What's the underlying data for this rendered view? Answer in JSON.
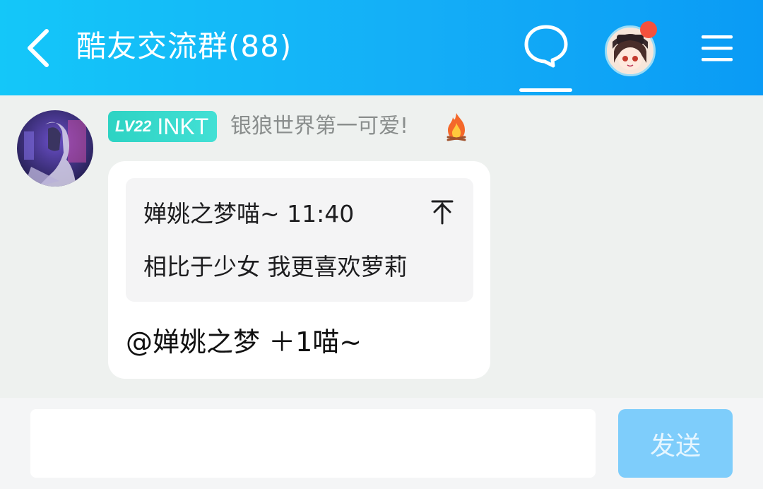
{
  "header": {
    "title": "酷友交流群(88)",
    "has_notification": true
  },
  "message": {
    "level_badge": "LV22",
    "tag": "INKT",
    "nickname": "银狼世界第一可爱!",
    "quote": {
      "author_time": "婵姚之梦喵~ 11:40",
      "text": "相比于少女 我更喜欢萝莉"
    },
    "reply": "@婵姚之梦 ＋1喵~"
  },
  "composer": {
    "input_value": "",
    "send_label": "发送"
  },
  "colors": {
    "header_start": "#14c7f9",
    "header_end": "#0a9bf5",
    "badge": "#2dd3c3",
    "send_disabled": "#7ecdfb",
    "notify": "#f5513d"
  },
  "icons": [
    "back-arrow-icon",
    "chat-bubble-icon",
    "menu-icon",
    "fire-icon",
    "pin-top-icon"
  ]
}
